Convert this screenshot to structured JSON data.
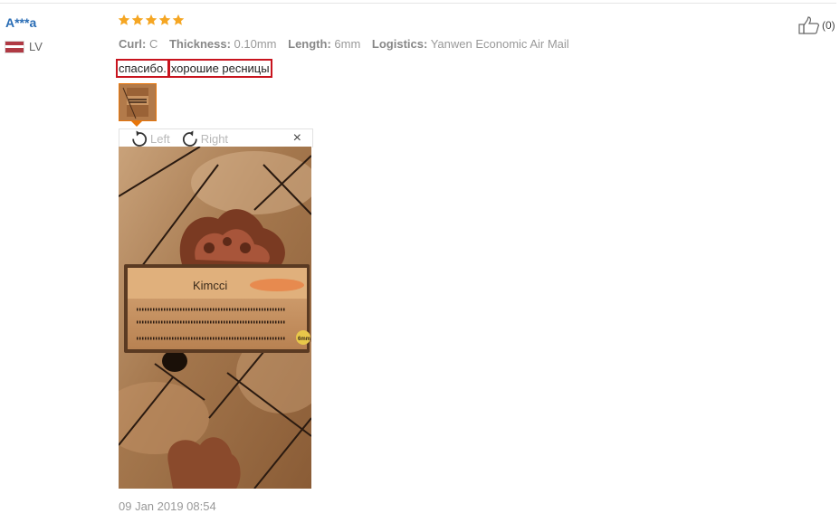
{
  "review": {
    "user_name": "A***a",
    "country_code": "LV",
    "rating": 5,
    "attributes": [
      {
        "label": "Curl:",
        "value": "C"
      },
      {
        "label": "Thickness:",
        "value": "0.10mm"
      },
      {
        "label": "Length:",
        "value": "6mm"
      },
      {
        "label": "Logistics:",
        "value": "Yanwen Economic Air Mail"
      }
    ],
    "text_parts": [
      "спасибо.",
      "хорошие ресницы"
    ],
    "date": "09 Jan 2019 08:54",
    "likes": "(0)"
  },
  "viewer": {
    "rotate_left_label": "Left",
    "rotate_right_label": "Right",
    "close_label": "×",
    "photo_brand": "Kimcci",
    "photo_size_badge": "6mm"
  },
  "colors": {
    "star": "#f5a623",
    "username": "#2a6db5",
    "highlight": "#c8141e",
    "thumb_border": "#e8760a"
  }
}
